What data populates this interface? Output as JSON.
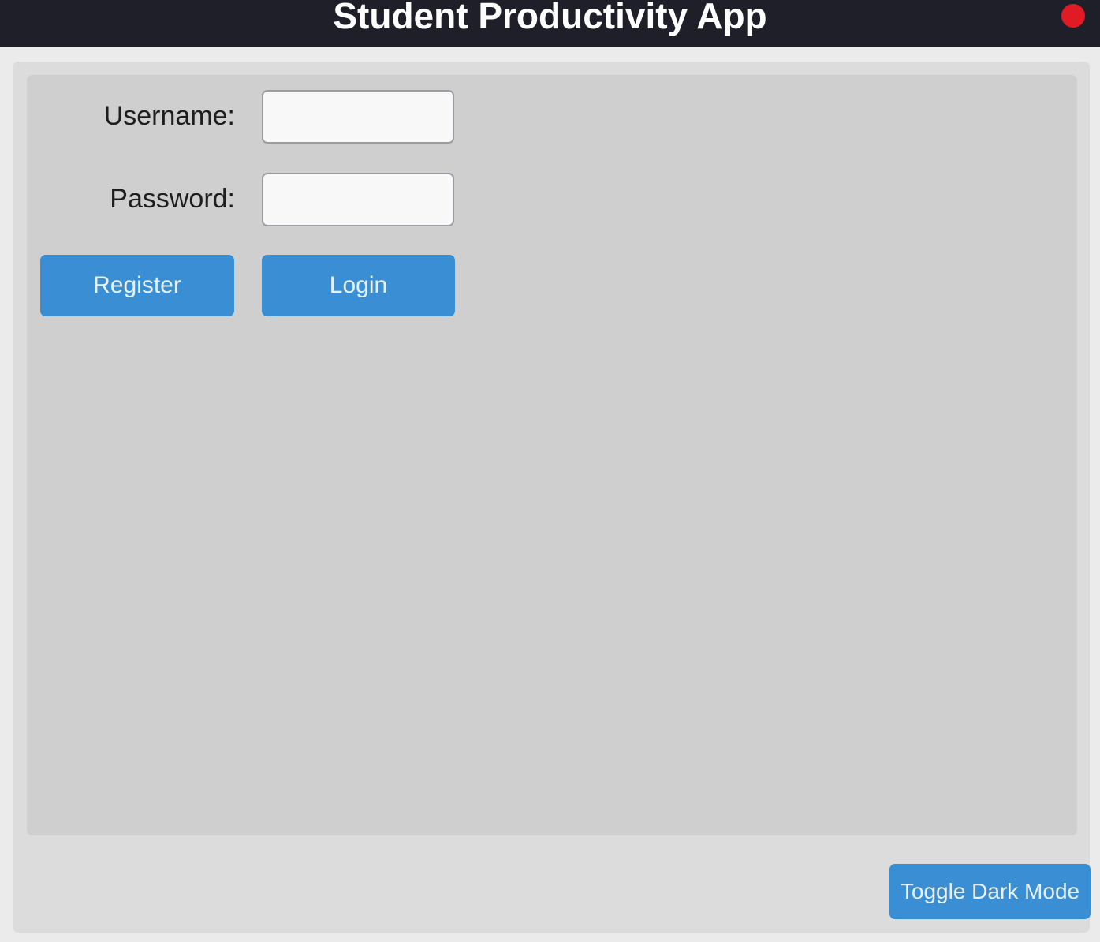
{
  "window": {
    "title": "Student Productivity App"
  },
  "form": {
    "username_label": "Username:",
    "password_label": "Password:",
    "username_value": "",
    "password_value": ""
  },
  "buttons": {
    "register_label": "Register",
    "login_label": "Login",
    "toggle_dark_mode_label": "Toggle Dark Mode"
  },
  "colors": {
    "titlebar": "#1f1f2a",
    "close": "#e01b24",
    "accent": "#3a8fd4"
  },
  "icons": {
    "close": "close-dot-icon"
  }
}
